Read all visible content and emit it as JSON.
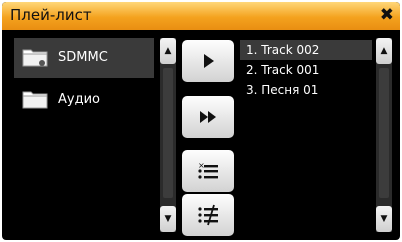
{
  "window": {
    "title": "Плей-лист",
    "close_glyph": "✖"
  },
  "sources": [
    {
      "label": "SDMMC",
      "icon": "sd-folder-icon",
      "selected": true
    },
    {
      "label": "Аудио",
      "icon": "folder-icon",
      "selected": false
    }
  ],
  "controls": [
    {
      "name": "play-button",
      "icon": "play-icon"
    },
    {
      "name": "fast-forward-button",
      "icon": "fast-forward-icon"
    },
    {
      "name": "remove-from-playlist-button",
      "icon": "remove-list-icon"
    },
    {
      "name": "clear-playlist-button",
      "icon": "clear-list-icon"
    }
  ],
  "playlist": {
    "tracks": [
      {
        "label": "1. Track 002",
        "selected": true
      },
      {
        "label": "2. Track 001",
        "selected": false
      },
      {
        "label": "3. Песня 01",
        "selected": false
      }
    ]
  },
  "colors": {
    "title_gradient_top": "#ffd77a",
    "title_gradient_bottom": "#e98e12",
    "background": "#000000",
    "selection": "#3a3a3a"
  }
}
